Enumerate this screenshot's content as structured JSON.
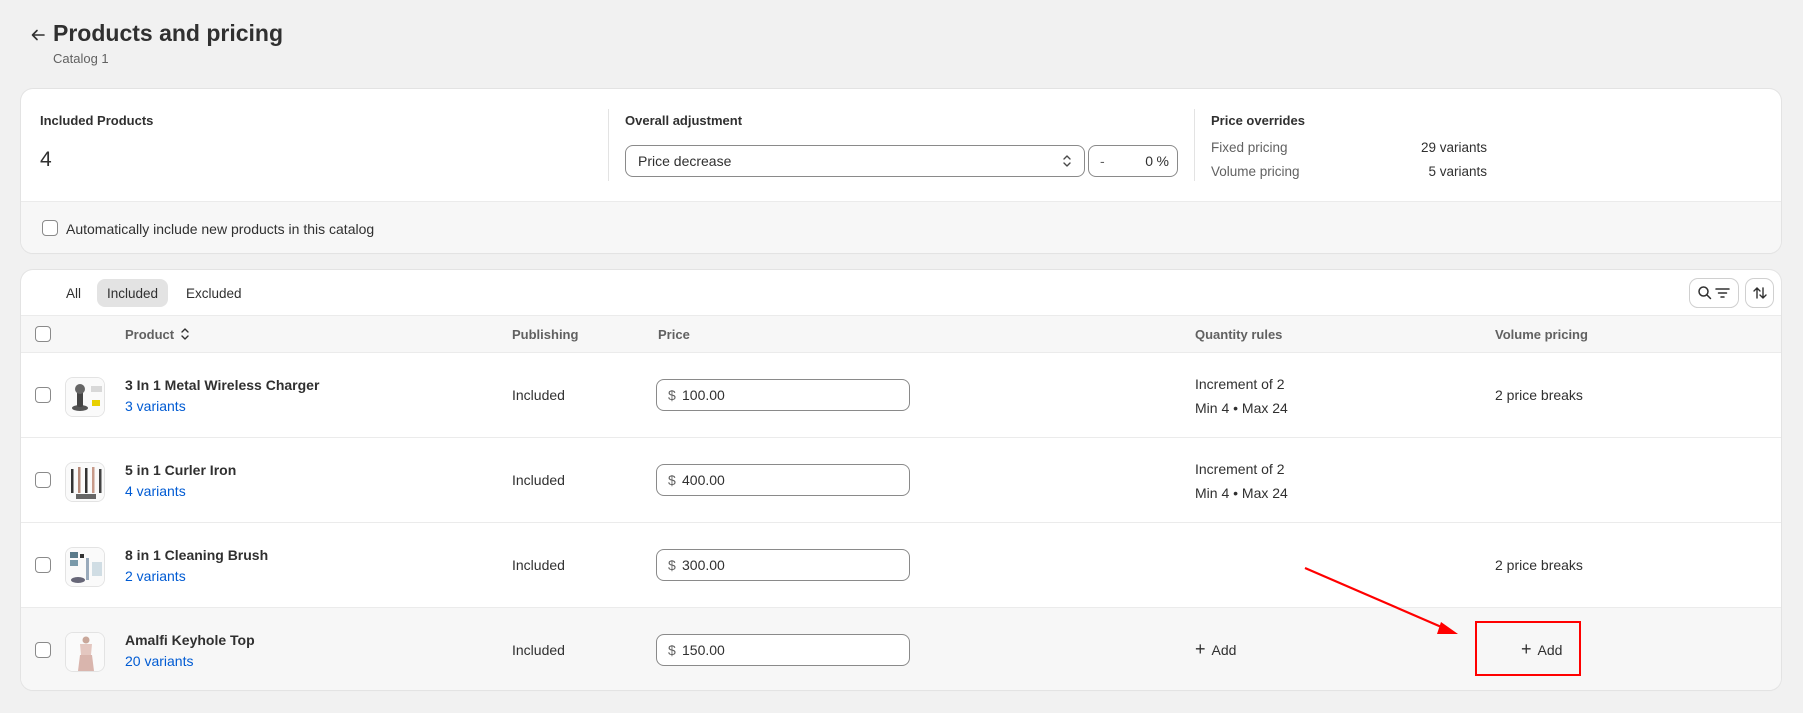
{
  "header": {
    "title": "Products and pricing",
    "subtitle": "Catalog 1"
  },
  "summary": {
    "included": {
      "title": "Included Products",
      "count": "4"
    },
    "adjustment": {
      "title": "Overall adjustment",
      "select_value": "Price decrease",
      "sign": "-",
      "percent": "0",
      "unit": "%"
    },
    "overrides": {
      "title": "Price overrides",
      "rows": [
        {
          "label": "Fixed pricing",
          "value": "29 variants"
        },
        {
          "label": "Volume pricing",
          "value": "5 variants"
        }
      ]
    },
    "auto_include_label": "Automatically include new products in this catalog"
  },
  "tabs": [
    "All",
    "Included",
    "Excluded"
  ],
  "active_tab": "Included",
  "table": {
    "headers": {
      "product": "Product",
      "publishing": "Publishing",
      "price": "Price",
      "quantity_rules": "Quantity rules",
      "volume_pricing": "Volume pricing"
    },
    "rows": [
      {
        "name": "3 In 1 Metal Wireless Charger",
        "variants": "3 variants",
        "publishing": "Included",
        "currency": "$",
        "price": "100.00",
        "quantity_rules": [
          "Increment of 2",
          "Min 4 • Max 24"
        ],
        "volume_pricing": "2 price breaks"
      },
      {
        "name": "5 in 1 Curler Iron",
        "variants": "4 variants",
        "publishing": "Included",
        "currency": "$",
        "price": "400.00",
        "quantity_rules": [
          "Increment of 2",
          "Min 4 • Max 24"
        ],
        "volume_pricing": ""
      },
      {
        "name": "8 in 1 Cleaning Brush",
        "variants": "2 variants",
        "publishing": "Included",
        "currency": "$",
        "price": "300.00",
        "quantity_rules": [],
        "volume_pricing": "2 price breaks"
      },
      {
        "name": "Amalfi Keyhole Top",
        "variants": "20 variants",
        "publishing": "Included",
        "currency": "$",
        "price": "150.00",
        "quantity_rules_add": "Add",
        "volume_pricing_add": "Add"
      }
    ]
  },
  "colors": {
    "link": "#005bd3",
    "annotation": "#ff0000",
    "background": "#f1f1f1"
  },
  "icons": {
    "back": "arrow-left-icon",
    "select": "chevron-up-down-icon",
    "search_filter": "search-filter-icon",
    "sort": "sort-icon",
    "add": "plus-icon"
  }
}
